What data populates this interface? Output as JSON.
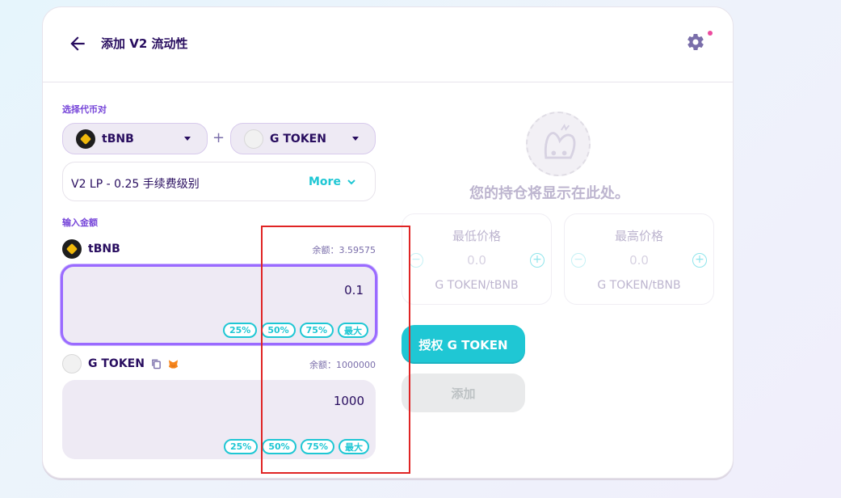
{
  "header": {
    "title": "添加 V2 流动性"
  },
  "pair": {
    "section_label": "选择代币对",
    "token_a": "tBNB",
    "token_b": "G TOKEN",
    "plus": "+"
  },
  "fee": {
    "label": "V2 LP - 0.25 手续费级别",
    "more": "More"
  },
  "amounts": {
    "section_label": "输入金额",
    "token_a": {
      "name": "tBNB",
      "balance": "余额：3.59575",
      "value": "0.1"
    },
    "token_b": {
      "name": "G TOKEN",
      "balance": "余额：1000000",
      "value": "1000"
    },
    "pct_buttons": [
      "25%",
      "50%",
      "75%",
      "最大"
    ]
  },
  "position": {
    "empty_text": "您的持仓将显示在此处。",
    "min": {
      "title": "最低价格",
      "value": "0.0",
      "unit": "G TOKEN/tBNB"
    },
    "max": {
      "title": "最高价格",
      "value": "0.0",
      "unit": "G TOKEN/tBNB"
    }
  },
  "actions": {
    "approve": "授权 G TOKEN",
    "add": "添加"
  },
  "colors": {
    "accent": "#1fc7d4",
    "primary_text": "#280d5f",
    "label": "#7645d9",
    "annotation": "#e02424"
  }
}
